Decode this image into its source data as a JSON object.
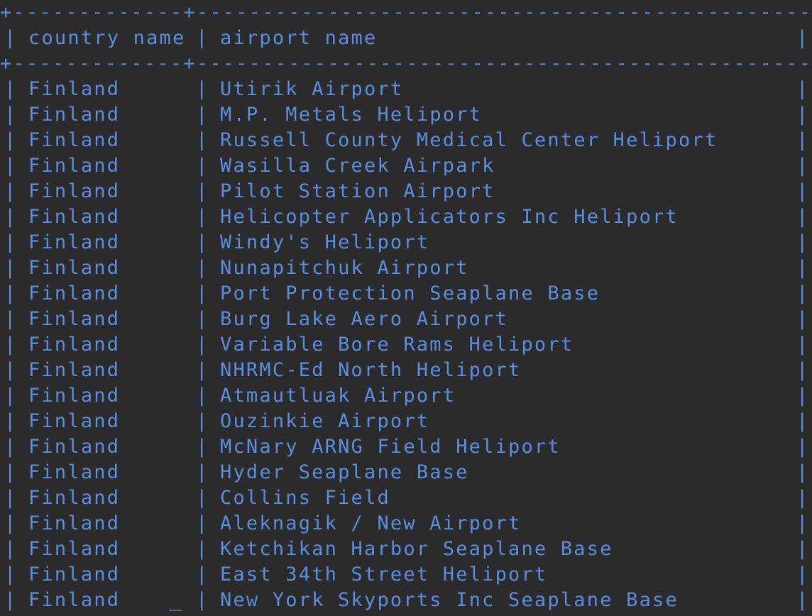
{
  "table": {
    "border_top": "+-------------+-------------------------------------------------+",
    "border_header": "+-------------+-------------------------------------------------+",
    "headers": [
      "country name",
      "airport name"
    ],
    "rows": [
      [
        "Finland",
        "Utirik Airport"
      ],
      [
        "Finland",
        "M.P. Metals Heliport"
      ],
      [
        "Finland",
        "Russell County Medical Center Heliport"
      ],
      [
        "Finland",
        "Wasilla Creek Airpark"
      ],
      [
        "Finland",
        "Pilot Station Airport"
      ],
      [
        "Finland",
        "Helicopter Applicators Inc Heliport"
      ],
      [
        "Finland",
        "Windy's Heliport"
      ],
      [
        "Finland",
        "Nunapitchuk Airport"
      ],
      [
        "Finland",
        "Port Protection Seaplane Base"
      ],
      [
        "Finland",
        "Burg Lake Aero Airport"
      ],
      [
        "Finland",
        "Variable Bore Rams Heliport"
      ],
      [
        "Finland",
        "NHRMC-Ed North Heliport"
      ],
      [
        "Finland",
        "Atmautluak Airport"
      ],
      [
        "Finland",
        "Ouzinkie Airport"
      ],
      [
        "Finland",
        "McNary ARNG Field Heliport"
      ],
      [
        "Finland",
        "Hyder Seaplane Base"
      ],
      [
        "Finland",
        "Collins Field"
      ],
      [
        "Finland",
        "Aleknagik / New Airport"
      ],
      [
        "Finland",
        "Ketchikan Harbor Seaplane Base"
      ],
      [
        "Finland",
        "East 34th Street Heliport"
      ],
      [
        "Finland",
        "New York Skyports Inc Seaplane Base"
      ]
    ]
  },
  "colors": {
    "background": "#2b2b2b",
    "text": "#5b8ee0"
  }
}
